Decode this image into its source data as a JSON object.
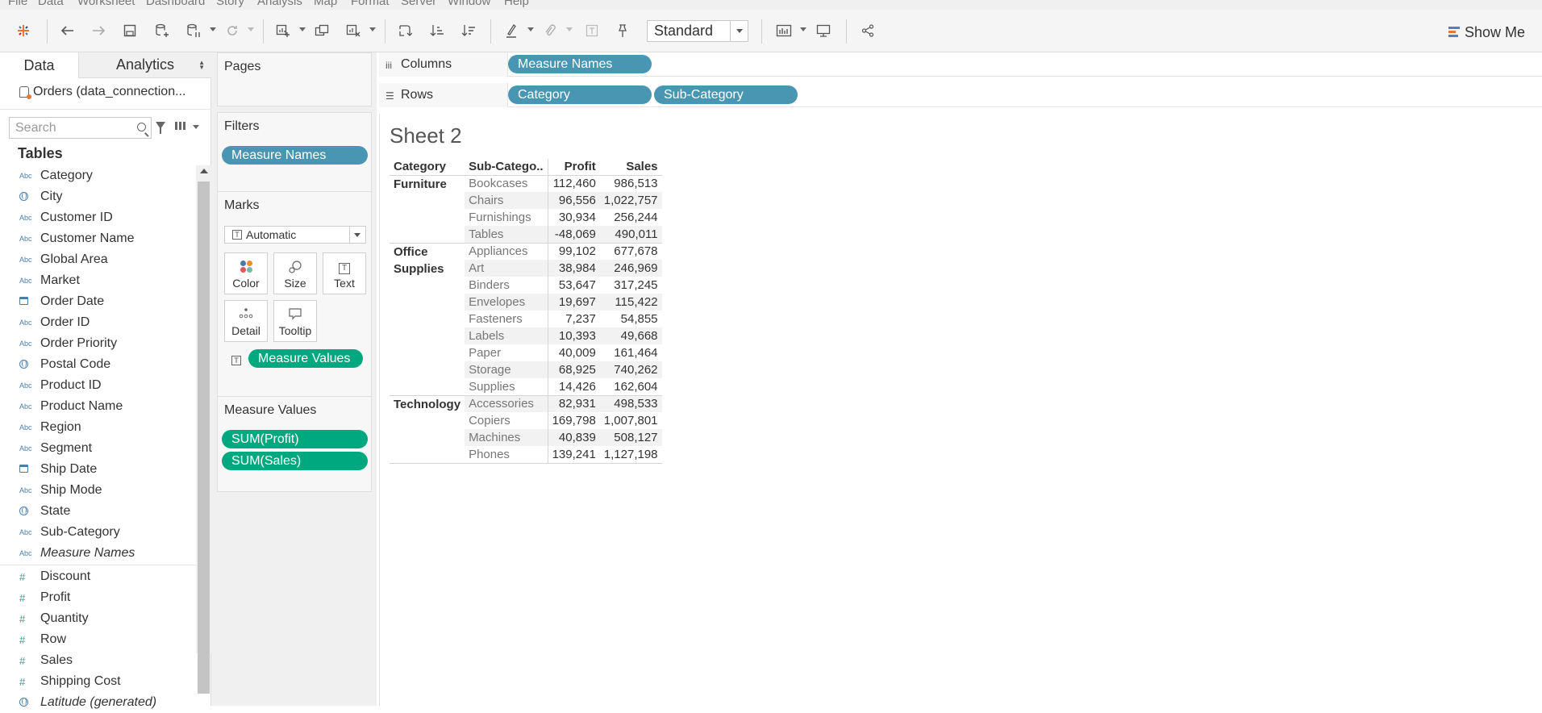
{
  "menu": [
    "File",
    "Data",
    "Worksheet",
    "Dashboard",
    "Story",
    "Analysis",
    "Map",
    "Format",
    "Server",
    "Window",
    "Help"
  ],
  "toolbar": {
    "fit_value": "Standard",
    "show_me_label": "Show Me",
    "icons": [
      "tableau-logo-icon",
      "undo-icon",
      "redo-icon",
      "save-icon",
      "new-datasource-icon",
      "pause-updates-icon",
      "refresh-icon",
      "new-worksheet-icon",
      "duplicate-sheet-icon",
      "clear-sheet-icon",
      "swap-icon",
      "sort-ascending-icon",
      "sort-descending-icon",
      "highlight-icon",
      "group-icon",
      "labels-icon",
      "fix-axes-icon",
      "chart-size-icon",
      "presentation-icon",
      "share-icon"
    ]
  },
  "data_pane": {
    "tab_data": "Data",
    "tab_analytics": "Analytics",
    "datasource": "Orders (data_connection...",
    "search_placeholder": "Search",
    "tables_title": "Tables",
    "dimensions": [
      {
        "name": "Category",
        "icon": "Abc"
      },
      {
        "name": "City",
        "icon": "globe"
      },
      {
        "name": "Customer ID",
        "icon": "Abc"
      },
      {
        "name": "Customer Name",
        "icon": "Abc"
      },
      {
        "name": "Global Area",
        "icon": "Abc"
      },
      {
        "name": "Market",
        "icon": "Abc"
      },
      {
        "name": "Order Date",
        "icon": "calendar"
      },
      {
        "name": "Order ID",
        "icon": "Abc"
      },
      {
        "name": "Order Priority",
        "icon": "Abc"
      },
      {
        "name": "Postal Code",
        "icon": "globe"
      },
      {
        "name": "Product ID",
        "icon": "Abc"
      },
      {
        "name": "Product Name",
        "icon": "Abc"
      },
      {
        "name": "Region",
        "icon": "Abc"
      },
      {
        "name": "Segment",
        "icon": "Abc"
      },
      {
        "name": "Ship Date",
        "icon": "calendar"
      },
      {
        "name": "Ship Mode",
        "icon": "Abc"
      },
      {
        "name": "State",
        "icon": "globe"
      },
      {
        "name": "Sub-Category",
        "icon": "Abc"
      },
      {
        "name": "Measure Names",
        "icon": "Abc",
        "italic": true
      }
    ],
    "measures": [
      {
        "name": "Discount",
        "icon": "#"
      },
      {
        "name": "Profit",
        "icon": "#"
      },
      {
        "name": "Quantity",
        "icon": "#"
      },
      {
        "name": "Row",
        "icon": "#"
      },
      {
        "name": "Sales",
        "icon": "#"
      },
      {
        "name": "Shipping Cost",
        "icon": "#"
      },
      {
        "name": "Latitude (generated)",
        "icon": "globe",
        "italic": true
      }
    ]
  },
  "cards": {
    "pages_title": "Pages",
    "filters_title": "Filters",
    "filters_pills": [
      "Measure Names"
    ],
    "marks_title": "Marks",
    "marks_type": "Automatic",
    "marks_buttons": [
      "Color",
      "Size",
      "Text",
      "Detail",
      "Tooltip"
    ],
    "marks_pill": "Measure Values",
    "measure_values_title": "Measure Values",
    "measure_values_pills": [
      "SUM(Profit)",
      "SUM(Sales)"
    ]
  },
  "shelves": {
    "columns_label": "Columns",
    "columns_pills": [
      "Measure Names"
    ],
    "rows_label": "Rows",
    "rows_pills": [
      "Category",
      "Sub-Category"
    ]
  },
  "sheet": {
    "title": "Sheet 2",
    "headers": [
      "Category",
      "Sub-Catego..",
      "Profit",
      "Sales"
    ],
    "groups": [
      {
        "category": "Furniture",
        "rows": [
          {
            "sub": "Bookcases",
            "profit": "112,460",
            "sales": "986,513"
          },
          {
            "sub": "Chairs",
            "profit": "96,556",
            "sales": "1,022,757"
          },
          {
            "sub": "Furnishings",
            "profit": "30,934",
            "sales": "256,244"
          },
          {
            "sub": "Tables",
            "profit": "-48,069",
            "sales": "490,011"
          }
        ]
      },
      {
        "category": "Office Supplies",
        "rows": [
          {
            "sub": "Appliances",
            "profit": "99,102",
            "sales": "677,678"
          },
          {
            "sub": "Art",
            "profit": "38,984",
            "sales": "246,969"
          },
          {
            "sub": "Binders",
            "profit": "53,647",
            "sales": "317,245"
          },
          {
            "sub": "Envelopes",
            "profit": "19,697",
            "sales": "115,422"
          },
          {
            "sub": "Fasteners",
            "profit": "7,237",
            "sales": "54,855"
          },
          {
            "sub": "Labels",
            "profit": "10,393",
            "sales": "49,668"
          },
          {
            "sub": "Paper",
            "profit": "40,009",
            "sales": "161,464"
          },
          {
            "sub": "Storage",
            "profit": "68,925",
            "sales": "740,262"
          },
          {
            "sub": "Supplies",
            "profit": "14,426",
            "sales": "162,604"
          }
        ]
      },
      {
        "category": "Technology",
        "rows": [
          {
            "sub": "Accessories",
            "profit": "82,931",
            "sales": "498,533"
          },
          {
            "sub": "Copiers",
            "profit": "169,798",
            "sales": "1,007,801"
          },
          {
            "sub": "Machines",
            "profit": "40,839",
            "sales": "508,127"
          },
          {
            "sub": "Phones",
            "profit": "139,241",
            "sales": "1,127,198"
          }
        ]
      }
    ]
  },
  "colors": {
    "dimension_pill": "#4996b2",
    "measure_pill": "#00a87f"
  }
}
